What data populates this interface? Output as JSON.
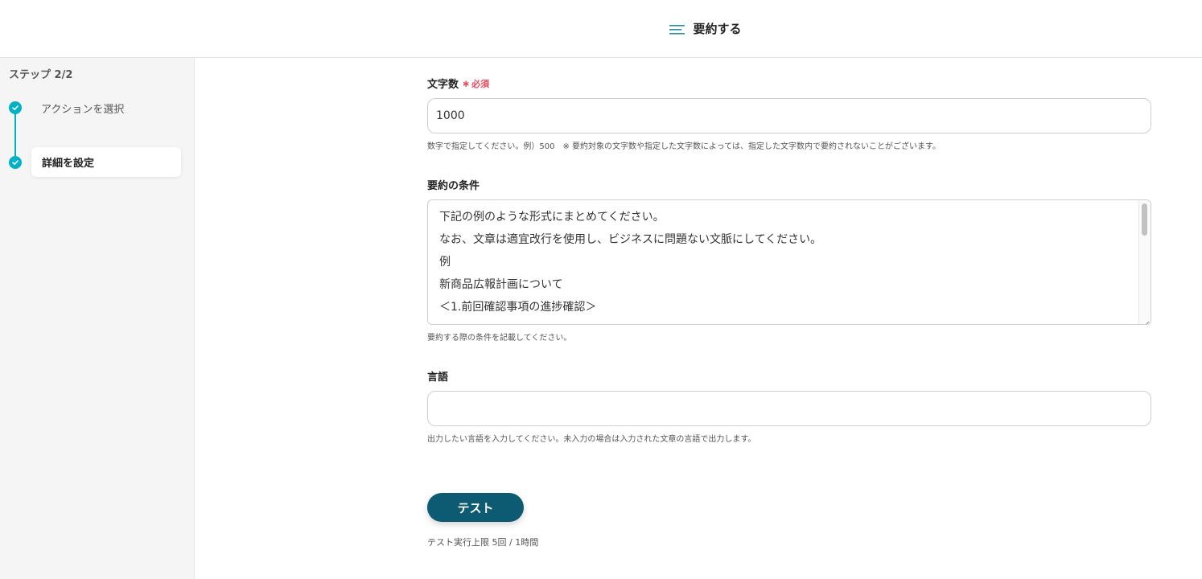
{
  "header": {
    "title": "要約する"
  },
  "sidebar": {
    "step_heading": "ステップ 2/2",
    "steps": [
      {
        "label": "アクションを選択",
        "state": "done"
      },
      {
        "label": "詳細を設定",
        "state": "current"
      }
    ]
  },
  "fields": {
    "char_count": {
      "label": "文字数",
      "required": "必須",
      "value": "1000",
      "help": "数字で指定してください。例）500　※ 要約対象の文字数や指定した文字数によっては、指定した文字数内で要約されないことがございます。"
    },
    "conditions": {
      "label": "要約の条件",
      "lines": [
        "下記の例のような形式にまとめてください。",
        "なお、文章は適宜改行を使用し、ビジネスに問題ない文脈にしてください。",
        "例",
        "新商品広報計画について",
        "＜1.前回確認事項の進捗確認＞"
      ],
      "help": "要約する際の条件を記載してください。"
    },
    "language": {
      "label": "言語",
      "value": "",
      "help": "出力したい言語を入力してください。未入力の場合は入力された文章の言語で出力します。"
    }
  },
  "actions": {
    "test_label": "テスト",
    "test_limit": "テスト実行上限 5回 / 1時間"
  },
  "colors": {
    "accent": "#00b1c9",
    "button": "#0d5b73",
    "required": "#e8485b"
  },
  "icons": {
    "header": "menu-lines-icon",
    "step_done": "check-circle-icon"
  }
}
